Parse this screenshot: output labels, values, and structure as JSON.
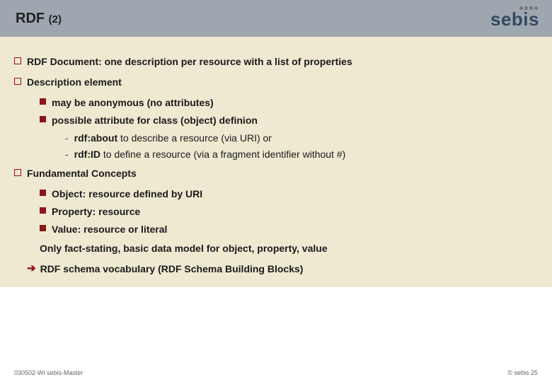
{
  "header": {
    "title_main": "RDF",
    "title_sub": "(2)",
    "logo_text": "sebis"
  },
  "bullets": {
    "b1": "RDF Document: one description per resource with a list of properties",
    "b2": "Description element",
    "b2_1": "may be anonymous (no attributes)",
    "b2_2": "possible attribute for class (object) definion",
    "b2_2_1_strong": "rdf:about",
    "b2_2_1_rest": " to describe a resource (via URI) or",
    "b2_2_2_strong": "rdf:ID",
    "b2_2_2_rest": " to define a resource (via a fragment identifier without #)",
    "b3": "Fundamental Concepts",
    "b3_1": "Object: resource defined by URI",
    "b3_2": "Property: resource",
    "b3_3": "Value: resource or literal",
    "b3_note": "Only fact-stating, basic data model for object, property, value",
    "b3_arrow": "RDF schema vocabulary (RDF Schema Building Blocks)"
  },
  "footer": {
    "left": "030502-Wi sebis-Master",
    "right": "© sebis 25"
  }
}
